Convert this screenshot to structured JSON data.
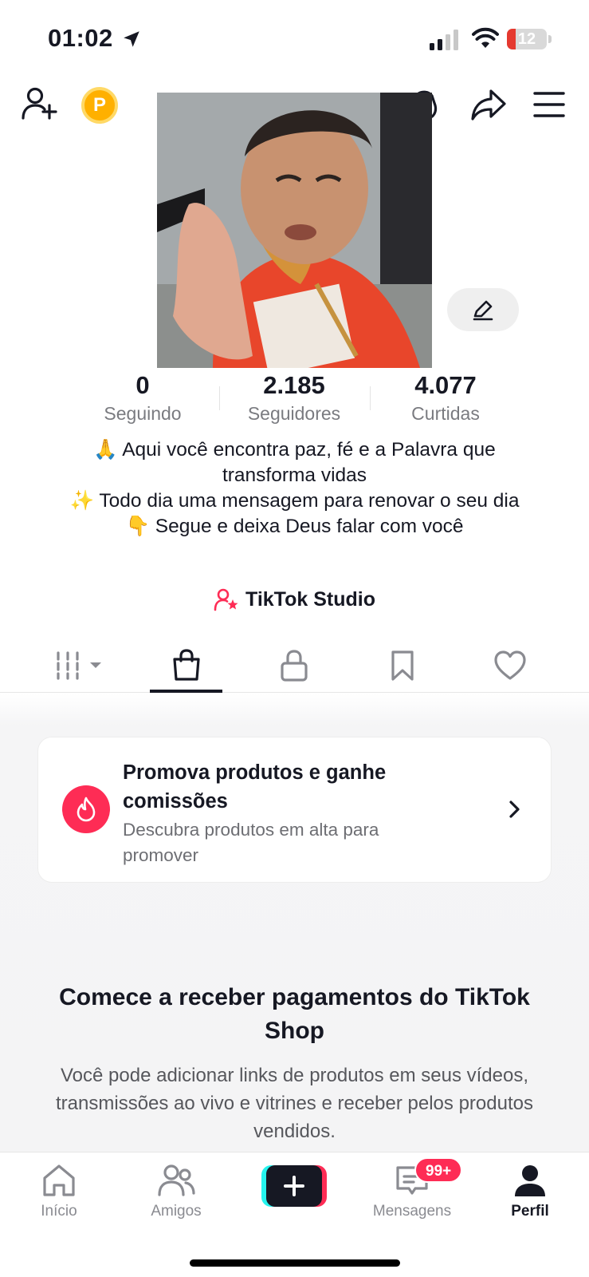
{
  "status_bar": {
    "time": "01:02",
    "battery_level": "12",
    "battery_fraction": 0.12,
    "icons": [
      "location-arrow-icon",
      "signal-icon",
      "wifi-icon",
      "battery-icon"
    ]
  },
  "header": {
    "points_badge": "P",
    "icons": [
      "add-friend-icon",
      "points-icon",
      "coin-icon",
      "share-icon",
      "menu-icon"
    ]
  },
  "stats": [
    {
      "value": "0",
      "label": "Seguindo"
    },
    {
      "value": "2.185",
      "label": "Seguidores"
    },
    {
      "value": "4.077",
      "label": "Curtidas"
    }
  ],
  "bio": {
    "line1": "🙏 Aqui você encontra paz, fé e a Palavra que transforma vidas",
    "line2": "✨ Todo dia uma mensagem para renovar o seu dia",
    "line3": "👇 Segue e deixa Deus falar com você"
  },
  "studio": {
    "label": "TikTok Studio"
  },
  "tabs": [
    {
      "icon": "grid-icon",
      "active": false
    },
    {
      "icon": "shopping-bag-icon",
      "active": true
    },
    {
      "icon": "lock-icon",
      "active": false
    },
    {
      "icon": "bookmark-icon",
      "active": false
    },
    {
      "icon": "heart-icon",
      "active": false
    }
  ],
  "promo": {
    "title": "Promova produtos e ganhe comissões",
    "subtitle": "Descubra produtos em alta para promover"
  },
  "shop": {
    "title": "Comece a receber pagamentos do TikTok Shop",
    "description": "Você pode adicionar links de produtos em seus vídeos, transmissões ao vivo e vitrines e receber pelos produtos vendidos."
  },
  "nav": {
    "home": "Início",
    "friends": "Amigos",
    "messages": "Mensagens",
    "messages_badge": "99+",
    "profile": "Perfil"
  },
  "colors": {
    "accent": "#fe2c55",
    "cyan": "#25f4ee",
    "text": "#161823",
    "muted": "#7a7b80"
  }
}
